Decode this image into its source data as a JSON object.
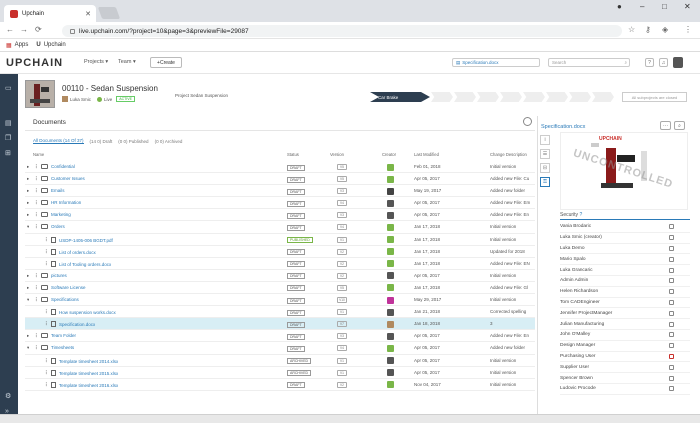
{
  "browser": {
    "tab_title": "Upchain",
    "url": "live.upchain.com/?project=10&page=3&previewFile=29087",
    "bookmarks": [
      "Apps",
      "Upchain"
    ]
  },
  "app": {
    "logo": "UPCHAIN",
    "nav": [
      "Projects",
      "Team"
    ],
    "create_label": "Create",
    "header_search_value": "Specification.docx",
    "search_placeholder": "Search"
  },
  "project": {
    "title": "00110 - Sedan Suspension",
    "owner": "Luka Smic",
    "state": "Live",
    "badge": "ACTIVE",
    "label": "Project Sedan Suspension",
    "current_stage": "Car Brake",
    "all_stages_label": "All subprojects are closed"
  },
  "documents": {
    "title": "Documents",
    "filters": [
      "All Documents (14 Of 37)",
      "(14 0) Draft",
      "(0 0) Published",
      "(0 0) Archived"
    ],
    "columns": [
      "Name",
      "Status",
      "Version",
      "Creator",
      "Last Modified",
      "Change Description"
    ],
    "rows": [
      {
        "kind": "folder",
        "level": 0,
        "expand": "▸",
        "name": "Confidential",
        "status": "DRAFT",
        "version": "V5",
        "creator_color": "#7ab648",
        "date": "Feb 01, 2018",
        "desc": "Initial version"
      },
      {
        "kind": "folder",
        "level": 0,
        "expand": "▸",
        "name": "Customer Issues",
        "status": "DRAFT",
        "version": "V5",
        "creator_color": "#7ab648",
        "date": "Apr 05, 2017",
        "desc": "Added new File: Cu"
      },
      {
        "kind": "folder",
        "level": 0,
        "expand": "▸",
        "name": "Emails",
        "status": "DRAFT",
        "version": "V3",
        "creator_color": "#444444",
        "date": "May 19, 2017",
        "desc": "Added new folder"
      },
      {
        "kind": "folder",
        "level": 0,
        "expand": "▸",
        "name": "HR Information",
        "status": "DRAFT",
        "version": "V4",
        "creator_color": "#555555",
        "date": "Apr 05, 2017",
        "desc": "Added new File: Em"
      },
      {
        "kind": "folder",
        "level": 0,
        "expand": "▸",
        "name": "Marketing",
        "status": "DRAFT",
        "version": "V3",
        "creator_color": "#555555",
        "date": "Apr 05, 2017",
        "desc": "Added new File: En"
      },
      {
        "kind": "folder",
        "level": 0,
        "expand": "▾",
        "name": "Orders",
        "status": "DRAFT",
        "version": "V4",
        "creator_color": "#7ab648",
        "date": "Jan 17, 2018",
        "desc": "Initial version"
      },
      {
        "kind": "file",
        "level": 1,
        "expand": "",
        "name": "USDP-1405-006 BGDT.pdf",
        "status": "PUBLISHED",
        "version": "V1",
        "creator_color": "#7ab648",
        "date": "Jan 17, 2018",
        "desc": "Initial version"
      },
      {
        "kind": "file",
        "level": 1,
        "expand": "",
        "name": "List of orders.docx",
        "status": "DRAFT",
        "version": "V2",
        "creator_color": "#7ab648",
        "date": "Jan 17, 2018",
        "desc": "Updated for 2018"
      },
      {
        "kind": "file",
        "level": 1,
        "expand": "",
        "name": "List of Tooling orders.docx",
        "status": "DRAFT",
        "version": "V2",
        "creator_color": "#7ab648",
        "date": "Jan 17, 2018",
        "desc": "Added new File: EN"
      },
      {
        "kind": "folder",
        "level": 0,
        "expand": "▸",
        "name": "pictures",
        "status": "DRAFT",
        "version": "V2",
        "creator_color": "#555555",
        "date": "Apr 05, 2017",
        "desc": "Initial version"
      },
      {
        "kind": "folder",
        "level": 0,
        "expand": "▸",
        "name": "Software License",
        "status": "DRAFT",
        "version": "V5",
        "creator_color": "#7ab648",
        "date": "Jan 17, 2018",
        "desc": "Added new File: Gl"
      },
      {
        "kind": "folder",
        "level": 0,
        "expand": "▾",
        "name": "Specifications",
        "status": "DRAFT",
        "version": "V10",
        "creator_color": "#c0339a",
        "date": "May 29, 2017",
        "desc": "Initial version"
      },
      {
        "kind": "file",
        "level": 1,
        "expand": "",
        "name": "How suspension works.docx",
        "status": "DRAFT",
        "version": "V1",
        "creator_color": "#555555",
        "date": "Jan 21, 2018",
        "desc": "Corrected spelling"
      },
      {
        "kind": "file",
        "level": 1,
        "expand": "",
        "name": "Specification.docx",
        "status": "DRAFT",
        "version": "V7",
        "creator_color": "#b08a60",
        "date": "Jan 18, 2018",
        "desc": "3",
        "selected": true
      },
      {
        "kind": "folder",
        "level": 0,
        "expand": "▸",
        "name": "Team Folder",
        "status": "DRAFT",
        "version": "V3",
        "creator_color": "#555555",
        "date": "Apr 05, 2017",
        "desc": "Added new File: En"
      },
      {
        "kind": "folder",
        "level": 0,
        "expand": "▾",
        "name": "Timesheets",
        "status": "DRAFT",
        "version": "V4",
        "creator_color": "#7ab648",
        "date": "Apr 05, 2017",
        "desc": "Added new folder"
      },
      {
        "kind": "file",
        "level": 1,
        "expand": "",
        "name": "Template timesheet 2014.xlsx",
        "status": "ARCHIVED",
        "version": "V1",
        "creator_color": "#555555",
        "date": "Apr 05, 2017",
        "desc": "Initial version"
      },
      {
        "kind": "file",
        "level": 1,
        "expand": "",
        "name": "Template timesheet 2015.xlsx",
        "status": "ARCHIVED",
        "version": "V1",
        "creator_color": "#555555",
        "date": "Apr 05, 2017",
        "desc": "Initial version"
      },
      {
        "kind": "file",
        "level": 1,
        "expand": "",
        "name": "Template timesheet 2016.xlsx",
        "status": "DRAFT",
        "version": "V2",
        "creator_color": "#7ab648",
        "date": "Nov 04, 2017",
        "desc": "Initial version"
      }
    ]
  },
  "preview": {
    "title": "Specification.docx",
    "doc_heading": "UPCHAIN",
    "watermark": "UNCONTROLLED",
    "security_label": "Security",
    "security_users": [
      {
        "name": "Vania Brodaric",
        "red": false
      },
      {
        "name": "Luka Smic (creator)",
        "red": false
      },
      {
        "name": "Luka Demo",
        "red": false
      },
      {
        "name": "Mario Spalo",
        "red": false
      },
      {
        "name": "Luka Grancaric",
        "red": false
      },
      {
        "name": "Admin Admin",
        "red": false
      },
      {
        "name": "Helen Richardson",
        "red": false
      },
      {
        "name": "Tom CADEngineer",
        "red": false
      },
      {
        "name": "Jennifer ProjectManager",
        "red": false
      },
      {
        "name": "Julian Manufacturing",
        "red": false
      },
      {
        "name": "John O'Malley",
        "red": false
      },
      {
        "name": "Design Manager",
        "red": false
      },
      {
        "name": "Purchasing User",
        "red": true
      },
      {
        "name": "Supplier User",
        "red": false
      },
      {
        "name": "Spencer Brown",
        "red": false
      },
      {
        "name": "Ludovic Procode",
        "red": false
      }
    ]
  }
}
